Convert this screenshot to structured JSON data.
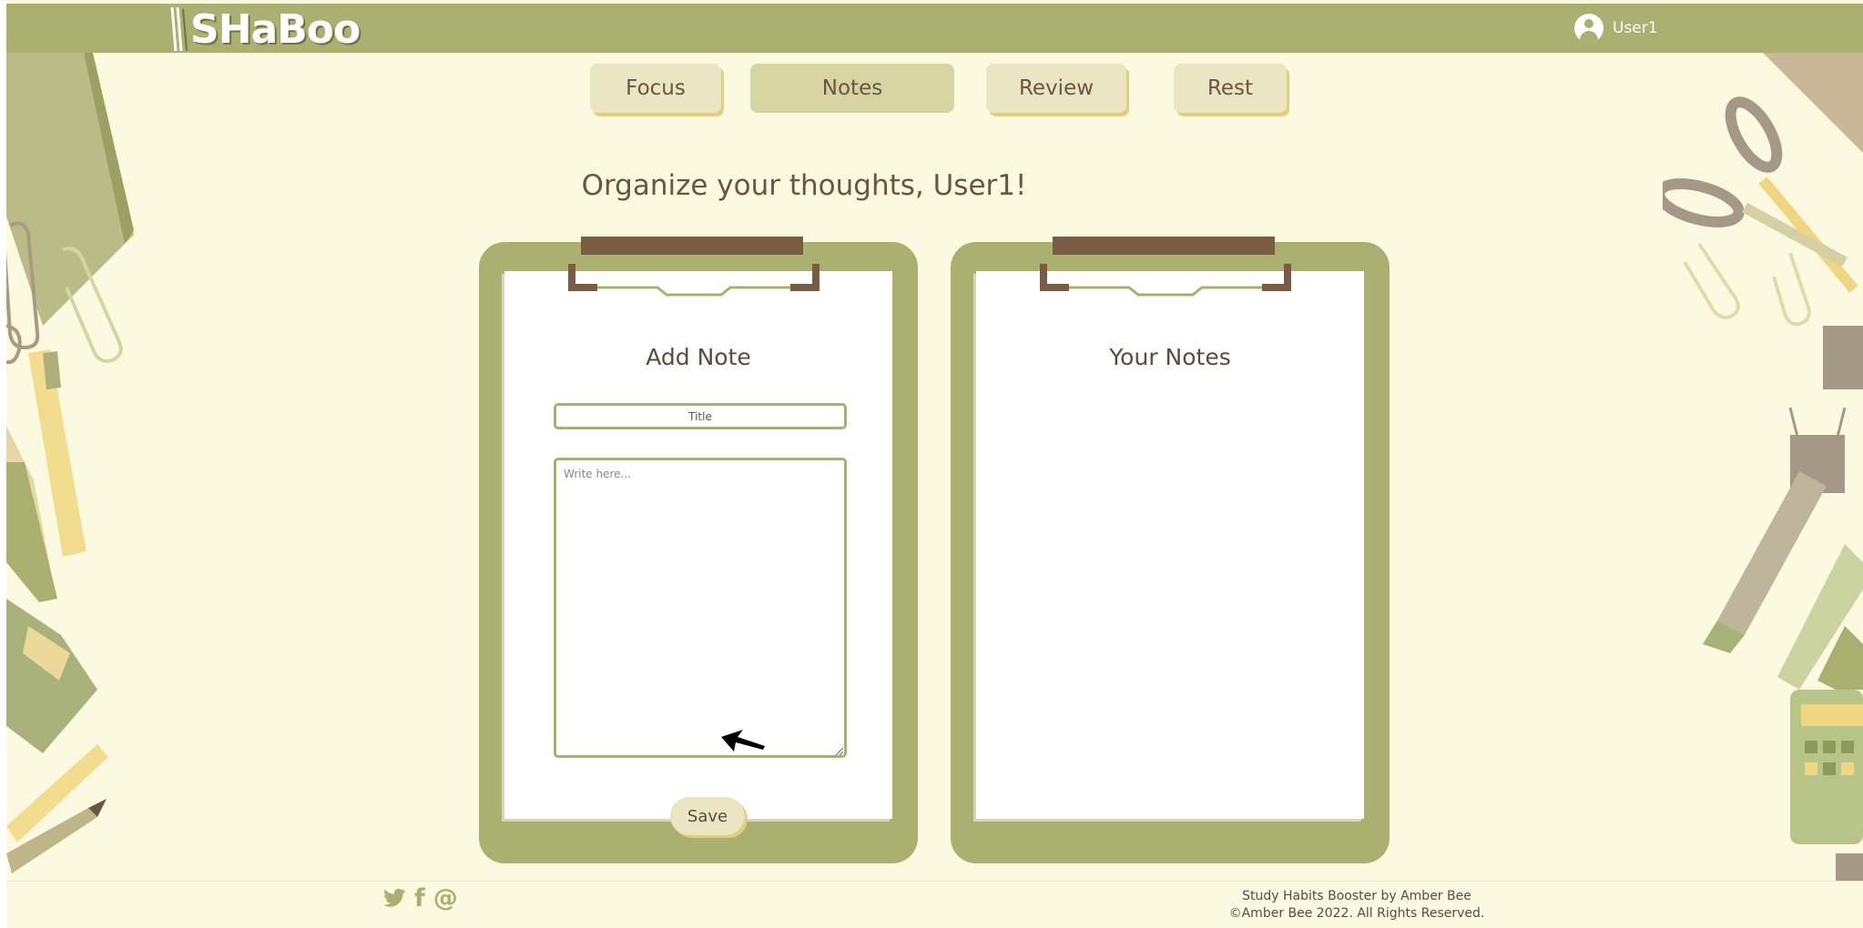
{
  "header": {
    "logo_text": "SHaBoo",
    "user_name": "User1"
  },
  "nav": {
    "tabs": [
      {
        "label": "Focus",
        "active": false
      },
      {
        "label": "Notes",
        "active": true
      },
      {
        "label": "Review",
        "active": false
      },
      {
        "label": "Rest",
        "active": false
      }
    ]
  },
  "main": {
    "headline": "Organize your thoughts, User1!",
    "add_note": {
      "title": "Add Note",
      "title_placeholder": "Title",
      "body_placeholder": "Write here...",
      "save_label": "Save"
    },
    "your_notes": {
      "title": "Your Notes"
    }
  },
  "footer": {
    "social_icons": [
      "twitter-icon",
      "facebook-icon",
      "email-icon"
    ],
    "social_glyphs": {
      "twitter": "🐦",
      "facebook": "f",
      "email": "@"
    },
    "credit_line1": "Study Habits Booster by Amber Bee",
    "credit_line2": "©Amber Bee 2022. All Rights Reserved."
  },
  "colors": {
    "header": "#aab06f",
    "background": "#fcf9e1",
    "tab": "#eae5c2",
    "tab_active": "#d6d5a1",
    "text": "#6a5542",
    "clip": "#7a5c45"
  }
}
